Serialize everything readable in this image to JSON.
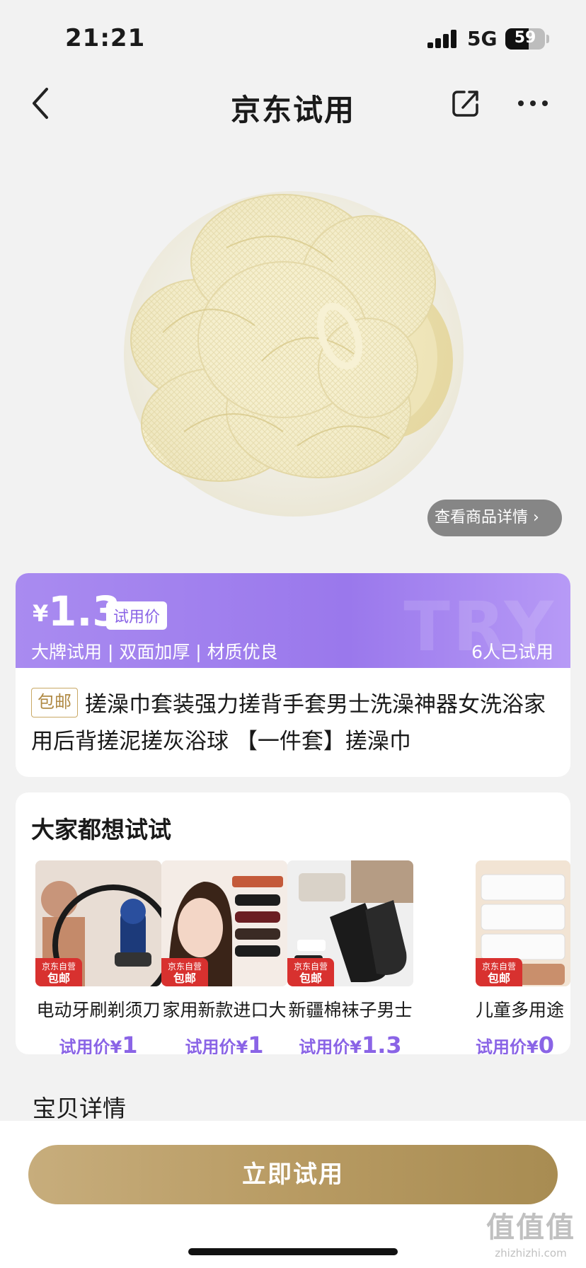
{
  "status_bar": {
    "time": "21:21",
    "network": "5G",
    "battery_level": "59",
    "battery_fraction": 0.59
  },
  "nav": {
    "title": "京东试用",
    "back_icon": "chevron-left-icon",
    "share_icon": "share-icon",
    "more_icon": "more-icon"
  },
  "product": {
    "image_icon": "bath-pouf-image",
    "detail_link": "查看商品详情 ›",
    "currency": "¥",
    "price": "1.3",
    "price_tag": "试用价",
    "watermark": "TRY",
    "features": "大牌试用 | 双面加厚 | 材质优良",
    "tried_count": "6人已试用",
    "shipping_tag": "包邮",
    "title": "搓澡巾套装强力搓背手套男士洗澡神器女洗浴家用后背搓泥搓灰浴球 【一件套】搓澡巾"
  },
  "recommend": {
    "title": "大家都想试试",
    "badge_top": "京东自营",
    "badge_bottom": "包邮",
    "items": [
      {
        "name": "电动牙刷剃须刀",
        "price_label": "试用价¥",
        "price": "1",
        "image": "shaver-image"
      },
      {
        "name": "家用新款进口大",
        "price_label": "试用价¥",
        "price": "1",
        "image": "hair-clip-image"
      },
      {
        "name": "新疆棉袜子男士",
        "price_label": "试用价¥",
        "price": "1.3",
        "image": "socks-image"
      },
      {
        "name": "儿童多用途",
        "price_label": "试用价¥",
        "price": "0",
        "image": "cotton-swab-image"
      }
    ]
  },
  "details": {
    "title": "宝贝详情"
  },
  "cta": {
    "label": "立即试用"
  },
  "site_mark": {
    "big": "值值值",
    "small": "zhizhizhi.com"
  },
  "colors": {
    "accent": "#9a78ec",
    "gold": "#b89b63",
    "badge": "#d8312f"
  }
}
